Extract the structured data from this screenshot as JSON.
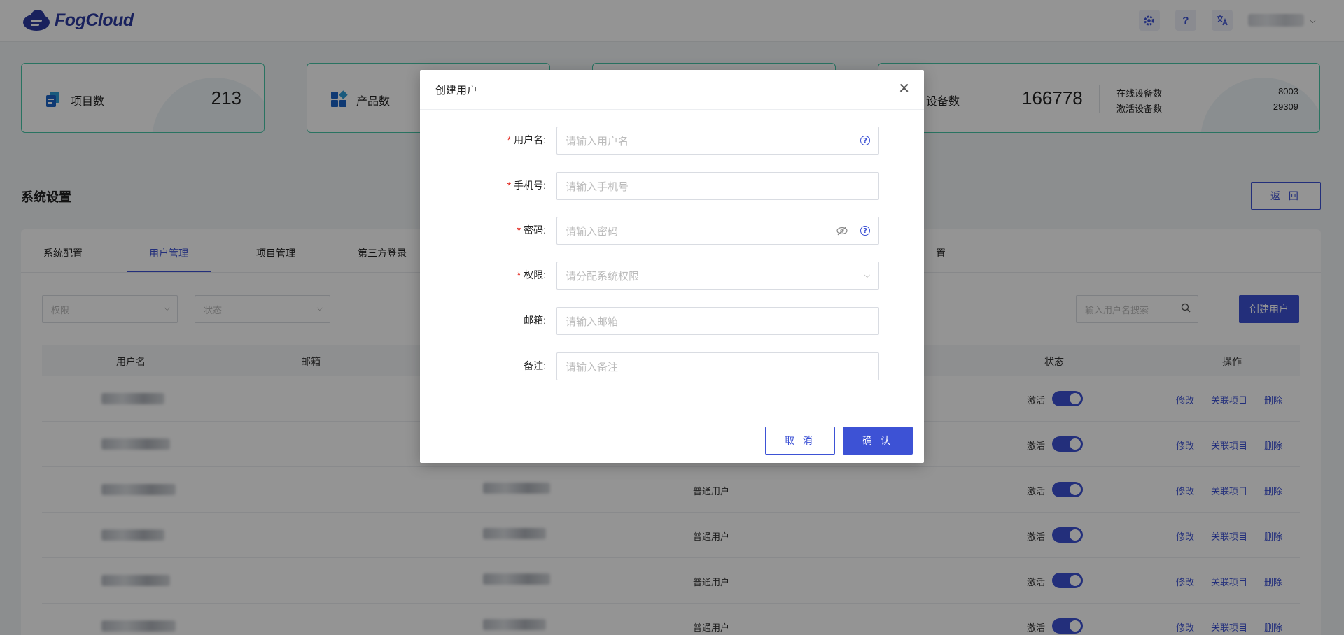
{
  "header": {
    "brand": "FogCloud",
    "icons": [
      "gear-icon",
      "help-icon",
      "translate-icon"
    ],
    "help_glyph": "?"
  },
  "stats": {
    "projects": {
      "label": "项目数",
      "value": "213"
    },
    "products": {
      "label": "产品数"
    },
    "devices": {
      "label": "设备数",
      "value": "166778",
      "online_label": "在线设备数",
      "online_value": "8003",
      "active_label": "激活设备数",
      "active_value": "29309"
    }
  },
  "page": {
    "title": "系统设置",
    "back_label": "返 回"
  },
  "tabs": [
    {
      "label": "系统配置",
      "active": false
    },
    {
      "label": "用户管理",
      "active": true
    },
    {
      "label": "项目管理",
      "active": false
    },
    {
      "label": "第三方登录",
      "active": false
    },
    {
      "label": "置",
      "active": false
    }
  ],
  "filters": {
    "permission_placeholder": "权限",
    "status_placeholder": "状态",
    "search_placeholder": "输入用户名搜索",
    "create_label": "创建用户"
  },
  "table": {
    "headers": [
      "用户名",
      "邮箱",
      "状态",
      "操作"
    ],
    "rows": [
      {
        "role": "",
        "status": "激活",
        "actions": [
          "修改",
          "关联项目",
          "删除"
        ]
      },
      {
        "role": "",
        "status": "激活",
        "actions": [
          "修改",
          "关联项目",
          "删除"
        ]
      },
      {
        "role": "普通用户",
        "status": "激活",
        "actions": [
          "修改",
          "关联项目",
          "删除"
        ]
      },
      {
        "role": "普通用户",
        "status": "激活",
        "actions": [
          "修改",
          "关联项目",
          "删除"
        ]
      },
      {
        "role": "普通用户",
        "status": "激活",
        "actions": [
          "修改",
          "关联项目",
          "删除"
        ]
      },
      {
        "role": "普通用户",
        "status": "激活",
        "actions": [
          "修改",
          "关联项目",
          "删除"
        ]
      }
    ]
  },
  "modal": {
    "title": "创建用户",
    "close_glyph": "✕",
    "fields": [
      {
        "label": "用户名:",
        "required": true,
        "placeholder": "请输入用户名"
      },
      {
        "label": "手机号:",
        "required": true,
        "placeholder": "请输入手机号"
      },
      {
        "label": "密码:",
        "required": true,
        "placeholder": "请输入密码"
      },
      {
        "label": "权限:",
        "required": true,
        "placeholder": "请分配系统权限"
      },
      {
        "label": "邮箱:",
        "required": false,
        "placeholder": "请输入邮箱"
      },
      {
        "label": "备注:",
        "required": false,
        "placeholder": "请输入备注"
      }
    ],
    "required_mark": "*",
    "cancel_label": "取 消",
    "confirm_label": "确 认"
  },
  "colors": {
    "primary": "#3d52d5",
    "card_border": "#47c6a7",
    "required": "#e2231a"
  }
}
